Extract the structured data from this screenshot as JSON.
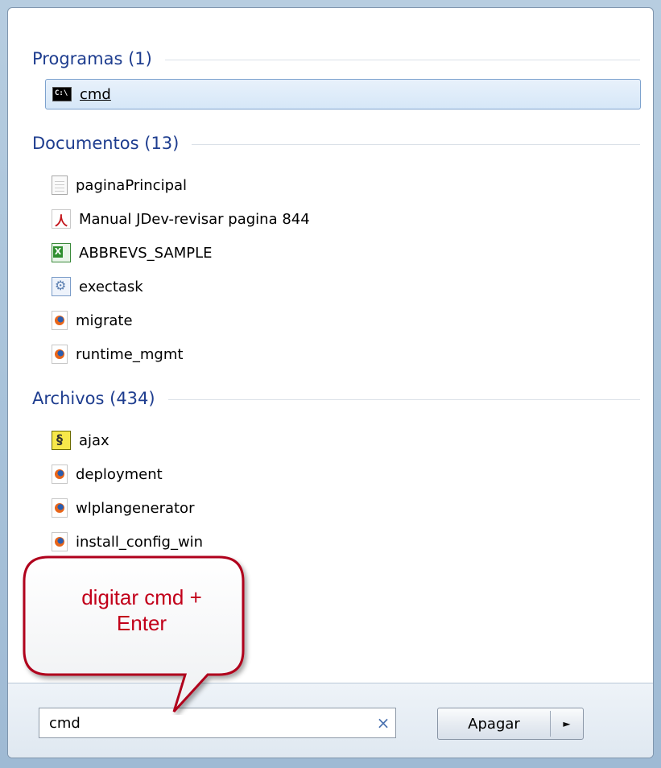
{
  "groups": [
    {
      "title": "Programas (1)",
      "items": [
        {
          "label": "cmd",
          "icon": "cmd-icon"
        }
      ]
    },
    {
      "title": "Documentos (13)",
      "items": [
        {
          "label": "paginaPrincipal",
          "icon": "text-document-icon"
        },
        {
          "label": "Manual JDev-revisar pagina 844",
          "icon": "pdf-icon"
        },
        {
          "label": "ABBREVS_SAMPLE",
          "icon": "excel-icon"
        },
        {
          "label": "exectask",
          "icon": "gear-document-icon"
        },
        {
          "label": "migrate",
          "icon": "firefox-document-icon"
        },
        {
          "label": "runtime_mgmt",
          "icon": "firefox-document-icon"
        }
      ]
    },
    {
      "title": "Archivos (434)",
      "items": [
        {
          "label": "ajax",
          "icon": "script-icon"
        },
        {
          "label": "deployment",
          "icon": "firefox-document-icon"
        },
        {
          "label": "wlplangenerator",
          "icon": "firefox-document-icon"
        },
        {
          "label": "install_config_win",
          "icon": "firefox-document-icon"
        }
      ]
    }
  ],
  "search": {
    "value": "cmd",
    "clear_glyph": "×"
  },
  "shutdown": {
    "label": "Apagar",
    "arrow_glyph": "►"
  },
  "callout": {
    "line1": "digitar cmd +",
    "line2": "Enter"
  },
  "colors": {
    "group_title": "#1e3d8f",
    "callout_text": "#c2001a",
    "callout_border": "#b0001a",
    "selection": "#d6e7f8"
  }
}
